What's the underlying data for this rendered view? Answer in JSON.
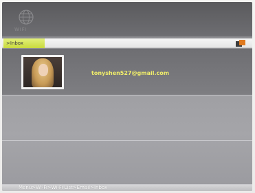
{
  "header": {
    "logo_text": "WiFi"
  },
  "breadcrumb_tab": {
    "label": ">Inbox"
  },
  "inbox": {
    "items": [
      {
        "email": "tonyshen527@gmail.com"
      }
    ]
  },
  "footer": {
    "path": "Menu>Wi-Fi>Wi-Fi List>Email>Inbox"
  },
  "colors": {
    "accent_tab": "#c8da3d",
    "email_text": "#f2ef6a",
    "corner_orange": "#e07a1f"
  },
  "icons": {
    "logo": "wifi-globe-icon",
    "corner": "device-corner-icon"
  }
}
